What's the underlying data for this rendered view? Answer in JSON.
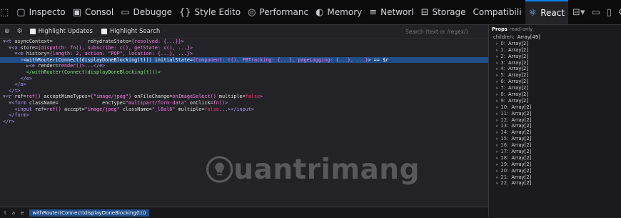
{
  "toolbar": {
    "tabs": [
      {
        "name": "tab-inspector",
        "icon": "inspector-icon",
        "glyph": "▢",
        "label": "Inspecto"
      },
      {
        "name": "tab-console",
        "icon": "console-icon",
        "glyph": "▣",
        "label": "Consol"
      },
      {
        "name": "tab-debugger",
        "icon": "debugger-icon",
        "glyph": "▭",
        "label": "Debugge"
      },
      {
        "name": "tab-style-editor",
        "icon": "braces-icon",
        "glyph": "{}",
        "label": "Style Edito"
      },
      {
        "name": "tab-performance",
        "icon": "performance-icon",
        "glyph": "◎",
        "label": "Performanc"
      },
      {
        "name": "tab-memory",
        "icon": "memory-icon",
        "glyph": "◐",
        "label": "Memory"
      },
      {
        "name": "tab-network",
        "icon": "network-icon",
        "glyph": "≡",
        "label": "Networl"
      },
      {
        "name": "tab-storage",
        "icon": "storage-icon",
        "glyph": "⊟",
        "label": "Storage"
      },
      {
        "name": "tab-compatibility",
        "icon": "",
        "glyph": "",
        "label": "Compatibili"
      },
      {
        "name": "tab-react",
        "icon": "react-icon",
        "glyph": "⚛",
        "label": "React"
      }
    ]
  },
  "filters": {
    "highlight_updates": "Highlight Updates",
    "highlight_search": "Highlight Search",
    "search_placeholder": "Search (text or /regex/)"
  },
  "tree_rows": [
    [
      {
        "t": "▼",
        "c": "dim"
      },
      {
        "t": "<t",
        "c": "tag"
      },
      {
        "t": " asyncContext=",
        "c": "attr"
      },
      {
        "t": "            rehydrateState=",
        "c": "attr"
      },
      {
        "t": "{resolved: {...}}",
        "c": "str"
      },
      {
        "t": ">",
        "c": "tag"
      }
    ],
    [
      {
        "t": "  ▼",
        "c": "dim"
      },
      {
        "t": "<a",
        "c": "tag"
      },
      {
        "t": " store=",
        "c": "attr"
      },
      {
        "t": "{dispatch: fn(), subscribe: c(), getState: u(), ...}",
        "c": "str"
      },
      {
        "t": ">",
        "c": "tag"
      }
    ],
    [
      {
        "t": "    ▼",
        "c": "dim"
      },
      {
        "t": "<e",
        "c": "tag"
      },
      {
        "t": " history=",
        "c": "attr"
      },
      {
        "t": "{length: 2, action: \"POP\", location: {...}, ...}",
        "c": "str"
      },
      {
        "t": ">",
        "c": "tag"
      }
    ],
    [
      {
        "t": "      ▼",
        "c": "dim"
      },
      {
        "t": "<withRouter(Connect(displayDoneBlocking(t)))",
        "c": "tag"
      },
      {
        "t": " initialState=",
        "c": "attr"
      },
      {
        "t": "{Component: t(), FBTracking: {...}, pageLogging: {...}, ...}",
        "c": "str"
      },
      {
        "t": "> == $r",
        "c": "tag"
      }
    ],
    [
      {
        "t": "        ▶",
        "c": "dim"
      },
      {
        "t": "<e",
        "c": "tag"
      },
      {
        "t": " render=",
        "c": "attr"
      },
      {
        "t": "render()",
        "c": "str"
      },
      {
        "t": ">...</e>",
        "c": "tag"
      }
    ],
    [
      {
        "t": "        ",
        "c": "dim"
      },
      {
        "t": "</withRouter(Connect(displayDoneBlocking(t)))>",
        "c": "green"
      }
    ],
    [
      {
        "t": "      ",
        "c": "dim"
      },
      {
        "t": "</e>",
        "c": "tag"
      }
    ],
    [
      {
        "t": "    ",
        "c": "dim"
      },
      {
        "t": "</a>",
        "c": "tag"
      }
    ],
    [
      {
        "t": "  ",
        "c": "dim"
      },
      {
        "t": "</t>",
        "c": "tag"
      }
    ],
    [
      {
        "t": "▼",
        "c": "dim"
      },
      {
        "t": "<r",
        "c": "tag"
      },
      {
        "t": " ref=",
        "c": "attr"
      },
      {
        "t": "ref()",
        "c": "str"
      },
      {
        "t": " acceptMimeTypes=",
        "c": "attr"
      },
      {
        "t": "{\"image/jpeg\"}",
        "c": "str"
      },
      {
        "t": " onFileChange=",
        "c": "attr"
      },
      {
        "t": "onImageSelect()",
        "c": "str"
      },
      {
        "t": " multiple=",
        "c": "attr"
      },
      {
        "t": "false",
        "c": "red"
      },
      {
        "t": ">",
        "c": "tag"
      }
    ],
    [
      {
        "t": "  ▼",
        "c": "dim"
      },
      {
        "t": "<form",
        "c": "tag"
      },
      {
        "t": " className=",
        "c": "attr"
      },
      {
        "t": "               encType=",
        "c": "attr"
      },
      {
        "t": "\"multipart/form-data\"",
        "c": "str"
      },
      {
        "t": " onClick=",
        "c": "attr"
      },
      {
        "t": "fn()",
        "c": "str"
      },
      {
        "t": ">",
        "c": "tag"
      }
    ],
    [
      {
        "t": "    ",
        "c": "dim"
      },
      {
        "t": "<input",
        "c": "tag"
      },
      {
        "t": " ref=",
        "c": "attr"
      },
      {
        "t": "ref()",
        "c": "str"
      },
      {
        "t": " accept=",
        "c": "attr"
      },
      {
        "t": "\"image/jpeg\"",
        "c": "str"
      },
      {
        "t": " className=",
        "c": "attr"
      },
      {
        "t": "\"_l8al6\"",
        "c": "str"
      },
      {
        "t": " multiple=",
        "c": "attr"
      },
      {
        "t": "false",
        "c": "red"
      },
      {
        "t": "...></input>",
        "c": "tag"
      }
    ],
    [
      {
        "t": "  ",
        "c": "dim"
      },
      {
        "t": "</form>",
        "c": "tag"
      }
    ],
    [
      {
        "t": "",
        "c": "dim"
      },
      {
        "t": "</r>",
        "c": "tag"
      }
    ]
  ],
  "breadcrumb": {
    "items": [
      "t",
      "a",
      "e"
    ],
    "current": "withRouter(Connect(displayDoneBlocking(t)))"
  },
  "props": {
    "title": "Props",
    "readonly": "read-only",
    "children_label": "children:",
    "children_value": "Array[49]",
    "items": [
      {
        "k": "0:",
        "v": "Array[2]"
      },
      {
        "k": "1:",
        "v": "Array[2]"
      },
      {
        "k": "2:",
        "v": "Array[2]"
      },
      {
        "k": "3:",
        "v": "Array[2]"
      },
      {
        "k": "4:",
        "v": "Array[2]"
      },
      {
        "k": "5:",
        "v": "Array[2]"
      },
      {
        "k": "6:",
        "v": "Array[2]"
      },
      {
        "k": "7:",
        "v": "Array[2]"
      },
      {
        "k": "8:",
        "v": "Array[2]"
      },
      {
        "k": "9:",
        "v": "Array[2]"
      },
      {
        "k": "10:",
        "v": "Array[2]"
      },
      {
        "k": "11:",
        "v": "Array[2]"
      },
      {
        "k": "12:",
        "v": "Array[2]"
      },
      {
        "k": "13:",
        "v": "Array[2]"
      },
      {
        "k": "14:",
        "v": "Array[2]"
      },
      {
        "k": "15:",
        "v": "Array[2]"
      },
      {
        "k": "16:",
        "v": "Array[2]"
      },
      {
        "k": "17:",
        "v": "Array[2]"
      },
      {
        "k": "18:",
        "v": "Array[2]"
      },
      {
        "k": "19:",
        "v": "Array[2]"
      },
      {
        "k": "20:",
        "v": "Array[2]"
      },
      {
        "k": "21:",
        "v": "Array[2]"
      },
      {
        "k": "22:",
        "v": "Array[2]"
      }
    ]
  },
  "watermark": {
    "text": "uantrimang"
  },
  "active_tab": "tab-react"
}
